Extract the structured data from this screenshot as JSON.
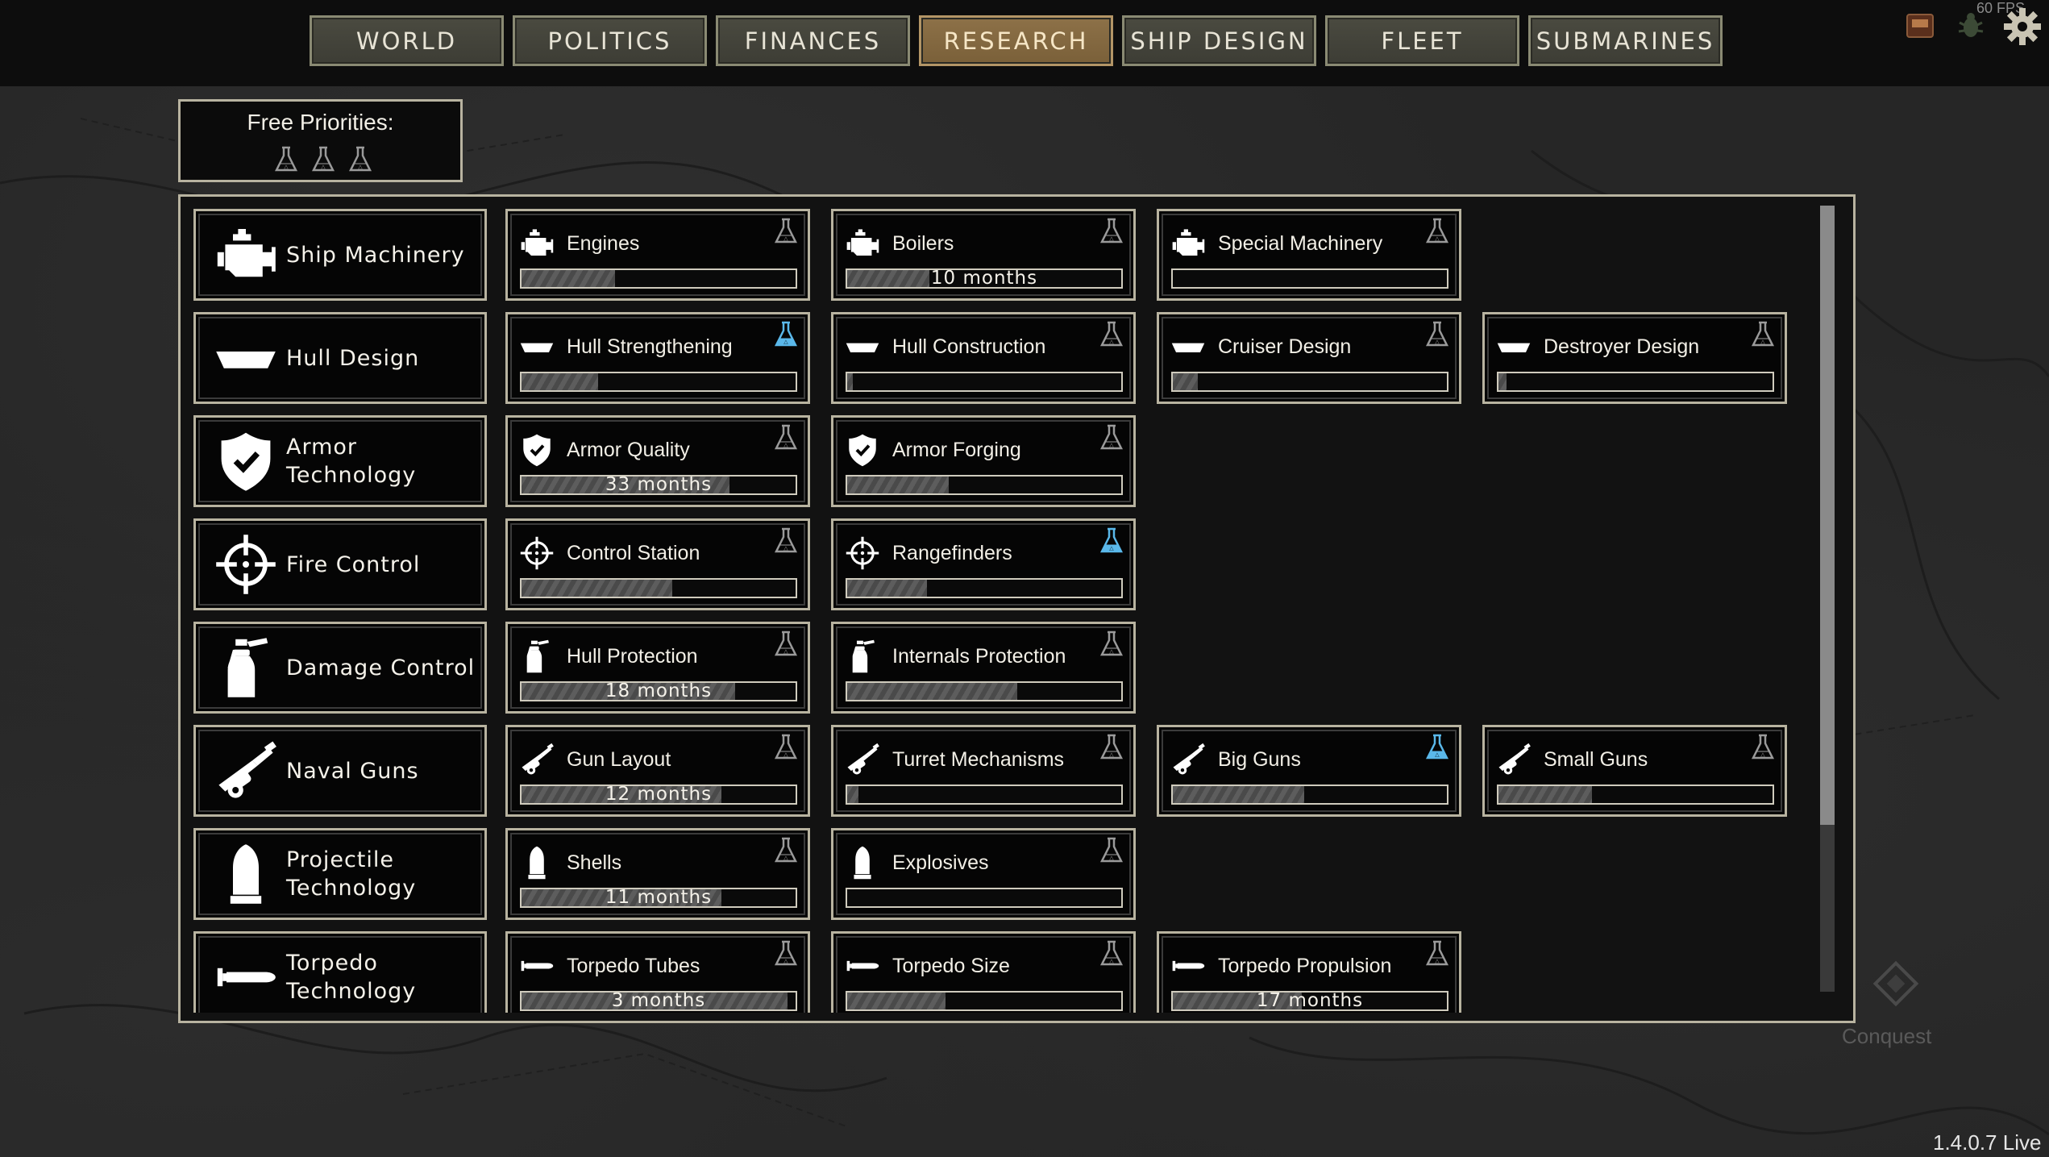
{
  "top_nav": {
    "tabs": [
      {
        "label": "WORLD",
        "active": false
      },
      {
        "label": "POLITICS",
        "active": false
      },
      {
        "label": "FINANCES",
        "active": false
      },
      {
        "label": "RESEARCH",
        "active": true
      },
      {
        "label": "SHIP DESIGN",
        "active": false
      },
      {
        "label": "FLEET",
        "active": false
      },
      {
        "label": "SUBMARINES",
        "active": false
      }
    ],
    "fps": "60 FPS"
  },
  "free_priorities": {
    "label": "Free Priorities:",
    "count": 3
  },
  "colors": {
    "accent_active_tab": "#7a6039",
    "priority_flask": "#4fb3e8",
    "border": "#b8b3a0"
  },
  "categories": [
    {
      "label": "Ship Machinery",
      "icon": "engine-icon",
      "techs": [
        {
          "name": "Engines",
          "icon": "engine-icon",
          "progress": 0.34,
          "time": "",
          "priority": false,
          "col": 0
        },
        {
          "name": "Boilers",
          "icon": "engine-icon",
          "progress": 0.3,
          "time": "10 months",
          "priority": false,
          "col": 1
        },
        {
          "name": "Special Machinery",
          "icon": "engine-icon",
          "progress": 0.0,
          "time": "",
          "priority": false,
          "col": 2
        }
      ]
    },
    {
      "label": "Hull Design",
      "icon": "hull-icon",
      "techs": [
        {
          "name": "Hull Strengthening",
          "icon": "hull-icon",
          "progress": 0.28,
          "time": "",
          "priority": true,
          "col": 0
        },
        {
          "name": "Hull Construction",
          "icon": "hull-icon",
          "progress": 0.02,
          "time": "",
          "priority": false,
          "col": 1
        },
        {
          "name": "Cruiser Design",
          "icon": "hull-icon",
          "progress": 0.09,
          "time": "",
          "priority": false,
          "col": 2
        },
        {
          "name": "Destroyer Design",
          "icon": "hull-icon",
          "progress": 0.03,
          "time": "",
          "priority": false,
          "col": 3
        }
      ]
    },
    {
      "label": "Armor\nTechnology",
      "icon": "shield-icon",
      "techs": [
        {
          "name": "Armor Quality",
          "icon": "shield-icon",
          "progress": 0.76,
          "time": "33 months",
          "priority": false,
          "col": 0
        },
        {
          "name": "Armor Forging",
          "icon": "shield-icon",
          "progress": 0.37,
          "time": "",
          "priority": false,
          "col": 1
        }
      ]
    },
    {
      "label": "Fire Control",
      "icon": "crosshair-icon",
      "techs": [
        {
          "name": "Control Station",
          "icon": "crosshair-icon",
          "progress": 0.55,
          "time": "",
          "priority": false,
          "col": 0
        },
        {
          "name": "Rangefinders",
          "icon": "crosshair-icon",
          "progress": 0.29,
          "time": "",
          "priority": true,
          "col": 1
        }
      ]
    },
    {
      "label": "Damage Control",
      "icon": "extinguisher-icon",
      "techs": [
        {
          "name": "Hull Protection",
          "icon": "extinguisher-icon",
          "progress": 0.78,
          "time": "18 months",
          "priority": false,
          "col": 0
        },
        {
          "name": "Internals Protection",
          "icon": "extinguisher-icon",
          "progress": 0.62,
          "time": "",
          "priority": false,
          "col": 1
        }
      ]
    },
    {
      "label": "Naval Guns",
      "icon": "gun-icon",
      "techs": [
        {
          "name": "Gun Layout",
          "icon": "gun-icon",
          "progress": 0.73,
          "time": "12 months",
          "priority": false,
          "col": 0
        },
        {
          "name": "Turret Mechanisms",
          "icon": "gun-icon",
          "progress": 0.04,
          "time": "",
          "priority": false,
          "col": 1
        },
        {
          "name": "Big Guns",
          "icon": "gun-icon",
          "progress": 0.48,
          "time": "",
          "priority": true,
          "col": 2
        },
        {
          "name": "Small Guns",
          "icon": "gun-icon",
          "progress": 0.34,
          "time": "",
          "priority": false,
          "col": 3
        }
      ]
    },
    {
      "label": "Projectile\nTechnology",
      "icon": "shell-icon",
      "techs": [
        {
          "name": "Shells",
          "icon": "shell-icon",
          "progress": 0.73,
          "time": "11 months",
          "priority": false,
          "col": 0
        },
        {
          "name": "Explosives",
          "icon": "shell-icon",
          "progress": 0.0,
          "time": "",
          "priority": false,
          "col": 1
        }
      ]
    },
    {
      "label": "Torpedo\nTechnology",
      "icon": "torpedo-icon",
      "techs": [
        {
          "name": "Torpedo Tubes",
          "icon": "torpedo-icon",
          "progress": 0.97,
          "time": "3 months",
          "priority": false,
          "col": 0
        },
        {
          "name": "Torpedo Size",
          "icon": "torpedo-icon",
          "progress": 0.36,
          "time": "",
          "priority": false,
          "col": 1
        },
        {
          "name": "Torpedo Propulsion",
          "icon": "torpedo-icon",
          "progress": 0.47,
          "time": "17 months",
          "priority": false,
          "col": 2
        }
      ]
    }
  ],
  "map_labels": {
    "conquest": "Conquest"
  },
  "version": "1.4.0.7 Live"
}
